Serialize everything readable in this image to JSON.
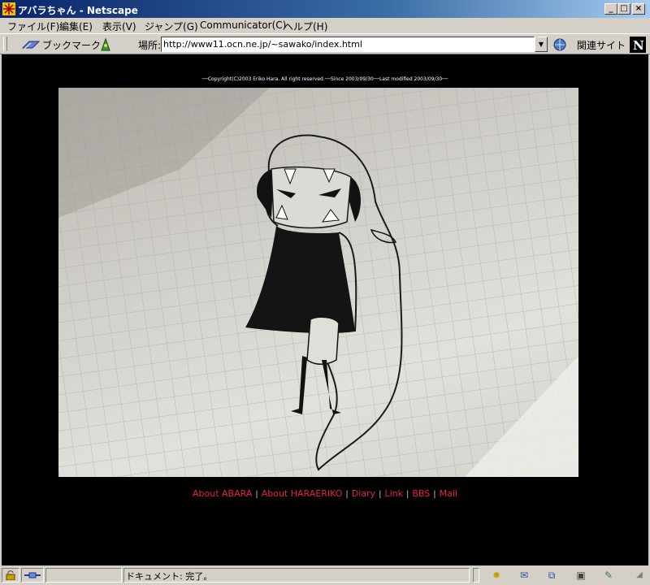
{
  "window": {
    "title": "アバラちゃん - Netscape",
    "controls": {
      "minimize": "_",
      "maximize": "□",
      "close": "×"
    }
  },
  "menu": {
    "items": [
      "ファイル(F)",
      "編集(E)",
      "表示(V)",
      "ジャンプ(G)",
      "Communicator(C)",
      "ヘルプ(H)"
    ]
  },
  "toolbar": {
    "bookmarks_label": "ブックマーク",
    "location_label": "場所:",
    "url": "http://www11.ocn.ne.jp/~sawako/index.html",
    "related_label": "関連サイト"
  },
  "page": {
    "copyright": "──Copyright(C)2003 Eriko Hara. All right reserved.──Since 2003/09/30──Last modified 2003/09/30──",
    "nav_links": [
      "About ABARA",
      "About HARAERIKO",
      "Diary",
      "Link",
      "BBS",
      "Mail"
    ],
    "separator": "|"
  },
  "status": {
    "text": "ドキュメント: 完了。"
  },
  "colors": {
    "link": "#e8204a",
    "page_background": "#000000",
    "chrome": "#d4d0c8",
    "titlebar": "#0a246a"
  }
}
